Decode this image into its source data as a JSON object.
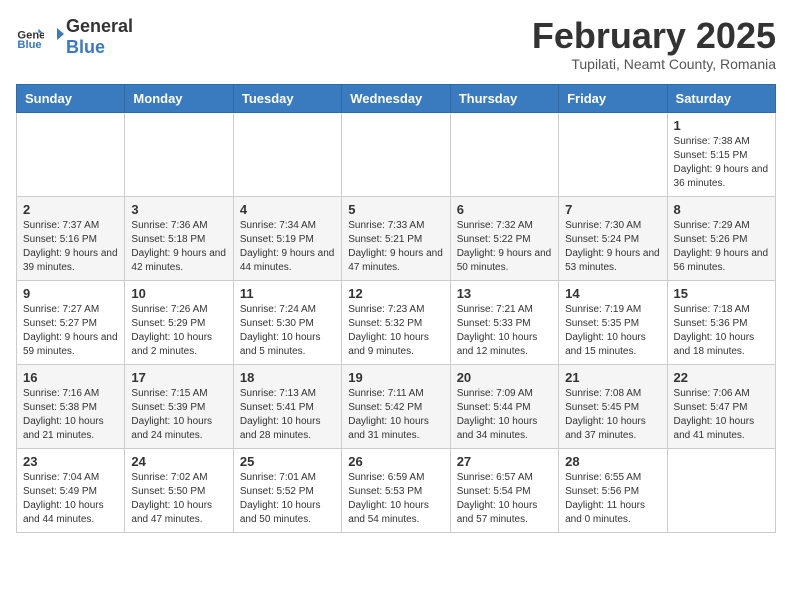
{
  "header": {
    "logo_general": "General",
    "logo_blue": "Blue",
    "month": "February 2025",
    "location": "Tupilati, Neamt County, Romania"
  },
  "weekdays": [
    "Sunday",
    "Monday",
    "Tuesday",
    "Wednesday",
    "Thursday",
    "Friday",
    "Saturday"
  ],
  "weeks": [
    [
      {
        "day": "",
        "info": ""
      },
      {
        "day": "",
        "info": ""
      },
      {
        "day": "",
        "info": ""
      },
      {
        "day": "",
        "info": ""
      },
      {
        "day": "",
        "info": ""
      },
      {
        "day": "",
        "info": ""
      },
      {
        "day": "1",
        "info": "Sunrise: 7:38 AM\nSunset: 5:15 PM\nDaylight: 9 hours and 36 minutes."
      }
    ],
    [
      {
        "day": "2",
        "info": "Sunrise: 7:37 AM\nSunset: 5:16 PM\nDaylight: 9 hours and 39 minutes."
      },
      {
        "day": "3",
        "info": "Sunrise: 7:36 AM\nSunset: 5:18 PM\nDaylight: 9 hours and 42 minutes."
      },
      {
        "day": "4",
        "info": "Sunrise: 7:34 AM\nSunset: 5:19 PM\nDaylight: 9 hours and 44 minutes."
      },
      {
        "day": "5",
        "info": "Sunrise: 7:33 AM\nSunset: 5:21 PM\nDaylight: 9 hours and 47 minutes."
      },
      {
        "day": "6",
        "info": "Sunrise: 7:32 AM\nSunset: 5:22 PM\nDaylight: 9 hours and 50 minutes."
      },
      {
        "day": "7",
        "info": "Sunrise: 7:30 AM\nSunset: 5:24 PM\nDaylight: 9 hours and 53 minutes."
      },
      {
        "day": "8",
        "info": "Sunrise: 7:29 AM\nSunset: 5:26 PM\nDaylight: 9 hours and 56 minutes."
      }
    ],
    [
      {
        "day": "9",
        "info": "Sunrise: 7:27 AM\nSunset: 5:27 PM\nDaylight: 9 hours and 59 minutes."
      },
      {
        "day": "10",
        "info": "Sunrise: 7:26 AM\nSunset: 5:29 PM\nDaylight: 10 hours and 2 minutes."
      },
      {
        "day": "11",
        "info": "Sunrise: 7:24 AM\nSunset: 5:30 PM\nDaylight: 10 hours and 5 minutes."
      },
      {
        "day": "12",
        "info": "Sunrise: 7:23 AM\nSunset: 5:32 PM\nDaylight: 10 hours and 9 minutes."
      },
      {
        "day": "13",
        "info": "Sunrise: 7:21 AM\nSunset: 5:33 PM\nDaylight: 10 hours and 12 minutes."
      },
      {
        "day": "14",
        "info": "Sunrise: 7:19 AM\nSunset: 5:35 PM\nDaylight: 10 hours and 15 minutes."
      },
      {
        "day": "15",
        "info": "Sunrise: 7:18 AM\nSunset: 5:36 PM\nDaylight: 10 hours and 18 minutes."
      }
    ],
    [
      {
        "day": "16",
        "info": "Sunrise: 7:16 AM\nSunset: 5:38 PM\nDaylight: 10 hours and 21 minutes."
      },
      {
        "day": "17",
        "info": "Sunrise: 7:15 AM\nSunset: 5:39 PM\nDaylight: 10 hours and 24 minutes."
      },
      {
        "day": "18",
        "info": "Sunrise: 7:13 AM\nSunset: 5:41 PM\nDaylight: 10 hours and 28 minutes."
      },
      {
        "day": "19",
        "info": "Sunrise: 7:11 AM\nSunset: 5:42 PM\nDaylight: 10 hours and 31 minutes."
      },
      {
        "day": "20",
        "info": "Sunrise: 7:09 AM\nSunset: 5:44 PM\nDaylight: 10 hours and 34 minutes."
      },
      {
        "day": "21",
        "info": "Sunrise: 7:08 AM\nSunset: 5:45 PM\nDaylight: 10 hours and 37 minutes."
      },
      {
        "day": "22",
        "info": "Sunrise: 7:06 AM\nSunset: 5:47 PM\nDaylight: 10 hours and 41 minutes."
      }
    ],
    [
      {
        "day": "23",
        "info": "Sunrise: 7:04 AM\nSunset: 5:49 PM\nDaylight: 10 hours and 44 minutes."
      },
      {
        "day": "24",
        "info": "Sunrise: 7:02 AM\nSunset: 5:50 PM\nDaylight: 10 hours and 47 minutes."
      },
      {
        "day": "25",
        "info": "Sunrise: 7:01 AM\nSunset: 5:52 PM\nDaylight: 10 hours and 50 minutes."
      },
      {
        "day": "26",
        "info": "Sunrise: 6:59 AM\nSunset: 5:53 PM\nDaylight: 10 hours and 54 minutes."
      },
      {
        "day": "27",
        "info": "Sunrise: 6:57 AM\nSunset: 5:54 PM\nDaylight: 10 hours and 57 minutes."
      },
      {
        "day": "28",
        "info": "Sunrise: 6:55 AM\nSunset: 5:56 PM\nDaylight: 11 hours and 0 minutes."
      },
      {
        "day": "",
        "info": ""
      }
    ]
  ]
}
